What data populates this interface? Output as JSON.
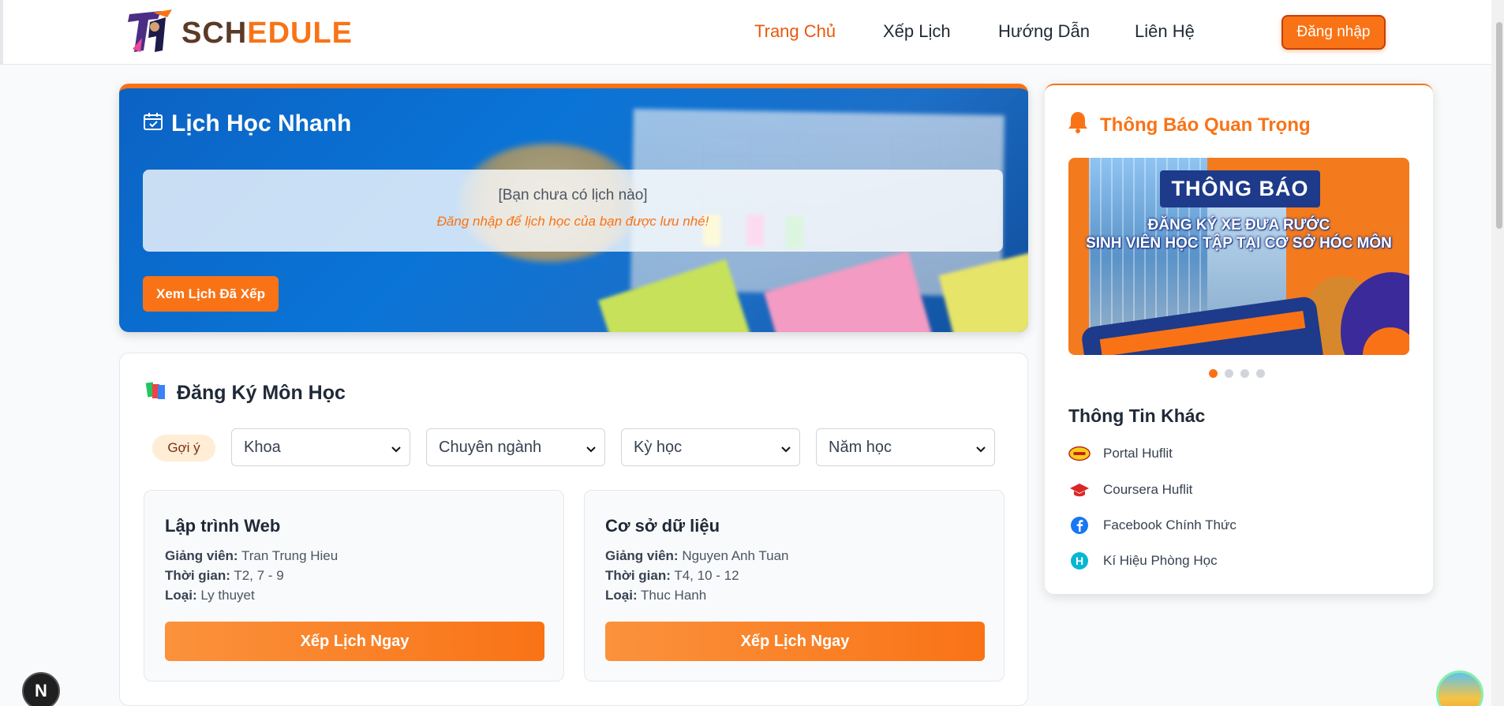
{
  "header": {
    "logo_part1": "SCH",
    "logo_part2": "EDULE",
    "nav": [
      "Trang Chủ",
      "Xếp Lịch",
      "Hướng Dẫn",
      "Liên Hệ"
    ],
    "login_label": "Đăng nhập"
  },
  "quick_schedule": {
    "title": "Lịch Học Nhanh",
    "empty_text": "[Bạn chưa có lịch nào]",
    "hint_text": "Đăng nhập để lịch học của bạn được lưu nhé!",
    "view_button": "Xem Lịch Đã Xếp"
  },
  "register": {
    "title": "Đăng Ký Môn Học",
    "suggest_label": "Gợi ý",
    "filters": [
      "Khoa",
      "Chuyên ngành",
      "Kỳ học",
      "Năm học"
    ],
    "labels": {
      "teacher": "Giảng viên:",
      "time": "Thời gian:",
      "type": "Loại:"
    },
    "courses": [
      {
        "name": "Lập trình Web",
        "teacher": "Tran Trung Hieu",
        "time": "T2, 7 - 9",
        "type": "Ly thuyet",
        "button": "Xếp Lịch Ngay"
      },
      {
        "name": "Cơ sở dữ liệu",
        "teacher": "Nguyen Anh Tuan",
        "time": "T4, 10 - 12",
        "type": "Thuc Hanh",
        "button": "Xếp Lịch Ngay"
      }
    ]
  },
  "notice": {
    "title": "Thông Báo Quan Trọng",
    "banner_heading": "THÔNG BÁO",
    "banner_line1": "ĐĂNG KÝ XE ĐƯA RƯỚC",
    "banner_line2": "SINH VIÊN HỌC TẬP TẠI CƠ SỞ HÓC MÔN",
    "slide_count": 4,
    "active_slide": 1,
    "other_title": "Thông Tin Khác",
    "links": [
      {
        "label": "Portal Huflit",
        "icon": "huflit-logo-icon"
      },
      {
        "label": "Coursera Huflit",
        "icon": "graduation-cap-icon"
      },
      {
        "label": "Facebook Chính Thức",
        "icon": "facebook-icon"
      },
      {
        "label": "Kí Hiệu Phòng Học",
        "icon": "h-circle-icon"
      }
    ]
  },
  "floating": {
    "dev_badge": "N"
  },
  "colors": {
    "accent": "#f97316",
    "blue_panel": "#0a74d6",
    "facebook": "#1877f2",
    "cyan": "#06b6d4"
  }
}
